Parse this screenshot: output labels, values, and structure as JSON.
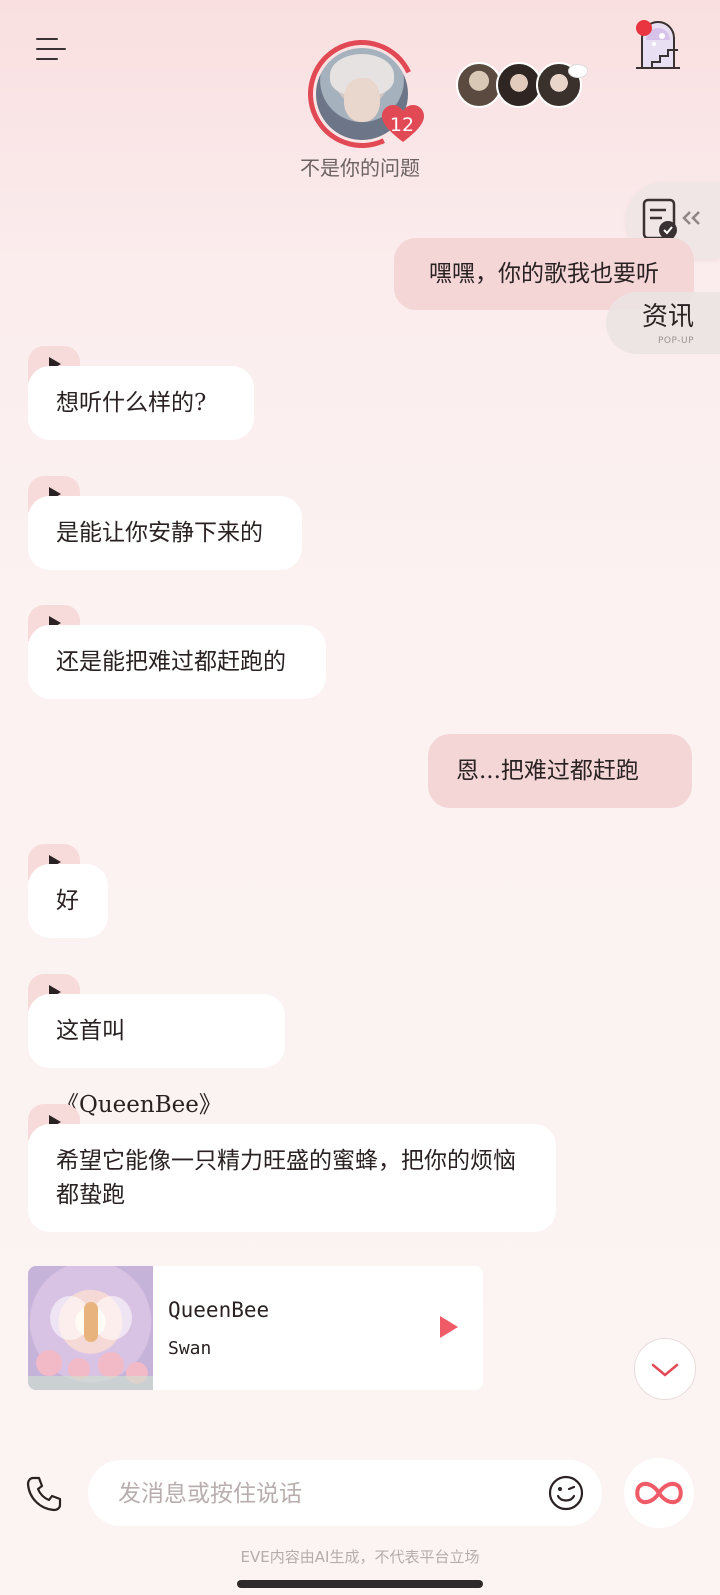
{
  "header": {
    "status_text": "不是你的问题",
    "affection_level": "12",
    "heart_color": "#e14a55"
  },
  "floating": {
    "news_label": "资讯",
    "news_sub": "POP-UP"
  },
  "messages": [
    {
      "role": "user",
      "text": "嘿嘿，你的歌我也要听"
    },
    {
      "role": "ai",
      "text": "想听什么样的?"
    },
    {
      "role": "ai",
      "text": "是能让你安静下来的"
    },
    {
      "role": "ai",
      "text": "还是能把难过都赶跑的"
    },
    {
      "role": "user",
      "text": "恩...把难过都赶跑"
    },
    {
      "role": "ai",
      "text": "好"
    },
    {
      "role": "ai",
      "text": "这首叫《QueenBee》"
    },
    {
      "role": "ai",
      "text": "希望它能像一只精力旺盛的蜜蜂，把你的烦恼都蛰跑"
    }
  ],
  "music_card": {
    "title": "QueenBee",
    "artist": "Swan",
    "play_color": "#ef5b66"
  },
  "input": {
    "placeholder": "发消息或按住说话"
  },
  "footer": {
    "disclaimer": "EVE内容由AI生成，不代表平台立场"
  },
  "colors": {
    "user_bubble": "#f4d6d7",
    "ai_bubble": "#ffffff",
    "accent": "#e14a55"
  }
}
